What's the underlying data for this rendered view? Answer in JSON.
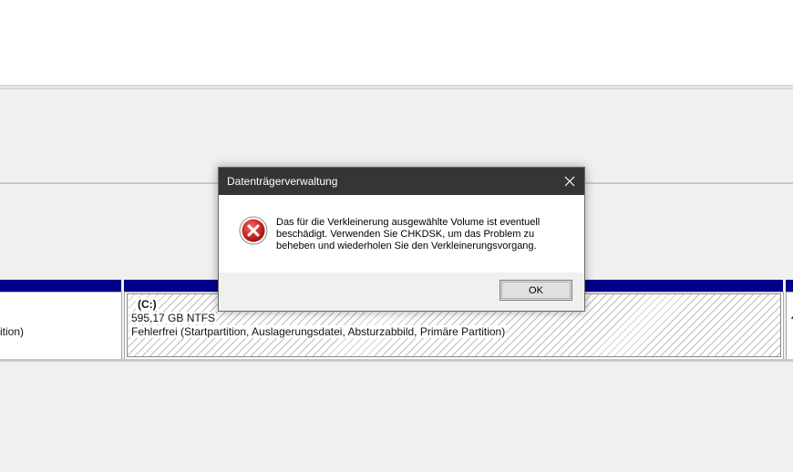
{
  "dialog": {
    "title": "Datenträgerverwaltung",
    "close_icon": "close-icon",
    "error_icon": "error-icon",
    "message": "Das für die Verkleinerung ausgewählte Volume ist eventuell beschädigt. Verwenden Sie CHKDSK, um das Problem zu beheben und wiederholen Sie den Verkleinerungsvorgang.",
    "ok_label": "OK"
  },
  "volumes": {
    "left_partial_status": "ition)",
    "c_drive": {
      "label": "(C:)",
      "size": "595,17 GB NTFS",
      "status": "Fehlerfrei (Startpartition, Auslagerungsdatei, Absturzabbild, Primäre Partition)"
    },
    "right_partial": "4"
  },
  "colors": {
    "titlebar": "#353535",
    "volume_bar": "#00008b",
    "error_red": "#c9232b"
  }
}
